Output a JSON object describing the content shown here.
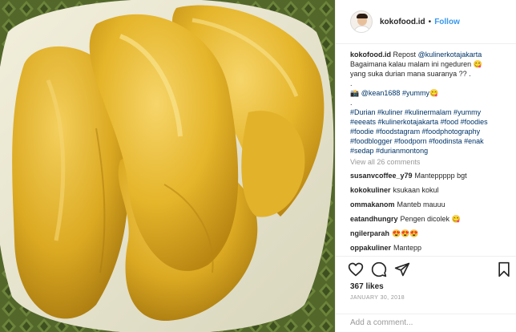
{
  "post": {
    "username": "kokofood.id",
    "separator": "•",
    "follow_label": "Follow",
    "image_alt": "durian"
  },
  "caption": {
    "username": "kokofood.id",
    "repost_text": "Repost",
    "repost_mention": "@kulinerkotajakarta",
    "line2": "Bagaimana kalau malam ini ngeduren 😋",
    "line3": "yang suka durian mana suaranya ?? .",
    "line4": ".",
    "line5_prefix": "📸",
    "line5_mention": "@kean1688",
    "line5_tag": "#yummy😋",
    "line6": ".",
    "tags": [
      "#Durian #kuliner #kulinermalam #yummy",
      "#eeeats #kulinerkotajakarta #food #foodies",
      "#foodie #foodstagram #foodphotography",
      "#foodblogger #foodporn #foodinsta #enak",
      "#sedap #durianmontong"
    ]
  },
  "view_all_comments": "View all 26 comments",
  "comments": [
    {
      "user": "susanvcoffee_y79",
      "text": "Manteppppp bgt"
    },
    {
      "user": "kokokuliner",
      "text": "ksukaan kokul"
    },
    {
      "user": "ommakanom",
      "text": "Manteb mauuu"
    },
    {
      "user": "eatandhungry",
      "text": "Pengen dicolek 😋"
    },
    {
      "user": "ngilerparah",
      "text": "😍😍😍"
    },
    {
      "user": "oppakuliner",
      "text": "Mantepp"
    }
  ],
  "likes": "367 likes",
  "date": "JANUARY 30, 2018",
  "add_comment_placeholder": "Add a comment...",
  "icons": [
    "heart-icon",
    "comment-icon",
    "share-icon",
    "bookmark-icon"
  ],
  "colors": {
    "link": "#003569",
    "follow": "#3897f0",
    "muted": "#999999",
    "durian_flesh": "#e8b830"
  }
}
